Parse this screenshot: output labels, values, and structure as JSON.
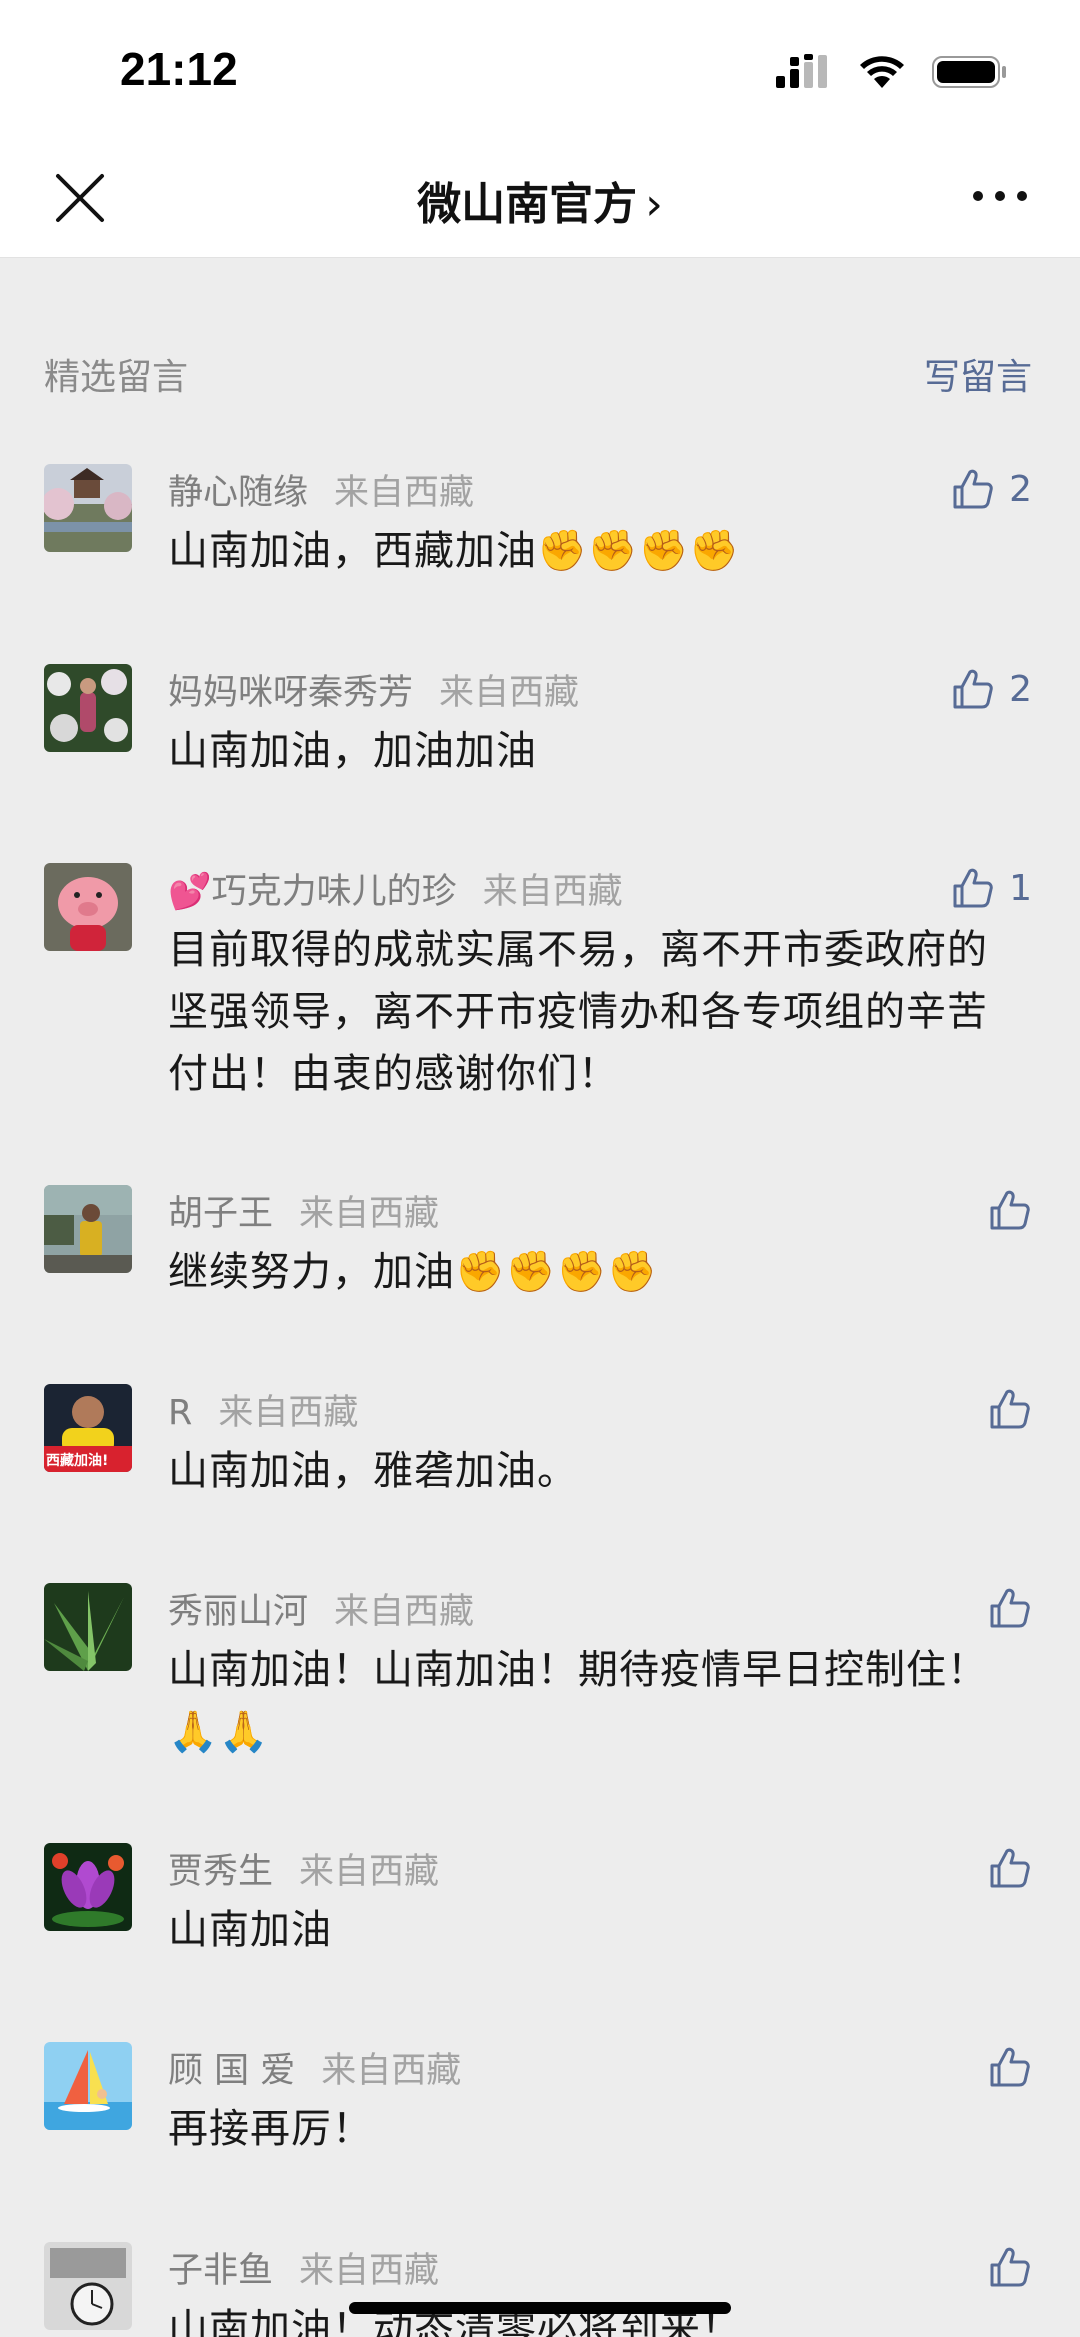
{
  "status_bar": {
    "time": "21:12"
  },
  "nav": {
    "title": "微山南官方",
    "chevron": "›"
  },
  "section": {
    "title": "精选留言",
    "write_label": "写留言"
  },
  "comments": [
    {
      "name": "静心随缘",
      "location": "来自西藏",
      "text": "山南加油，西藏加油✊✊✊✊",
      "likes": "2",
      "avatar": "landscape-avatar"
    },
    {
      "name": "妈妈咪呀秦秀芳",
      "location": "来自西藏",
      "text": "山南加油，加油加油",
      "likes": "2",
      "avatar": "flowers-avatar"
    },
    {
      "name": "💕巧克力味儿的珍",
      "location": "来自西藏",
      "text": "目前取得的成就实属不易，离不开市委政府的坚强领导，离不开市疫情办和各专项组的辛苦付出！由衷的感谢你们！",
      "likes": "1",
      "avatar": "pink-pig-avatar"
    },
    {
      "name": "胡子王",
      "location": "来自西藏",
      "text": "继续努力，加油✊✊✊✊",
      "likes": "",
      "avatar": "person-outdoor-avatar"
    },
    {
      "name": "R",
      "location": "来自西藏",
      "text": "山南加油，雅砻加油。",
      "likes": "",
      "avatar": "football-avatar",
      "avatar_text": "西藏加油!"
    },
    {
      "name": "秀丽山河",
      "location": "来自西藏",
      "text": "山南加油！山南加油！期待疫情早日控制住！🙏🙏",
      "likes": "",
      "avatar": "plant-avatar"
    },
    {
      "name": "贾秀生",
      "location": "来自西藏",
      "text": "山南加油",
      "likes": "",
      "avatar": "lotus-avatar"
    },
    {
      "name": "顾 国 爱",
      "location": "来自西藏",
      "text": "再接再厉！",
      "likes": "",
      "avatar": "windsurf-avatar"
    },
    {
      "name": "子非鱼",
      "location": "来自西藏",
      "text": "山南加油！动态清零必将到来！",
      "likes": "",
      "avatar": "watch-avatar"
    }
  ],
  "colors": {
    "link": "#576b95",
    "background": "#ededed",
    "meta": "#8a8a8a"
  }
}
